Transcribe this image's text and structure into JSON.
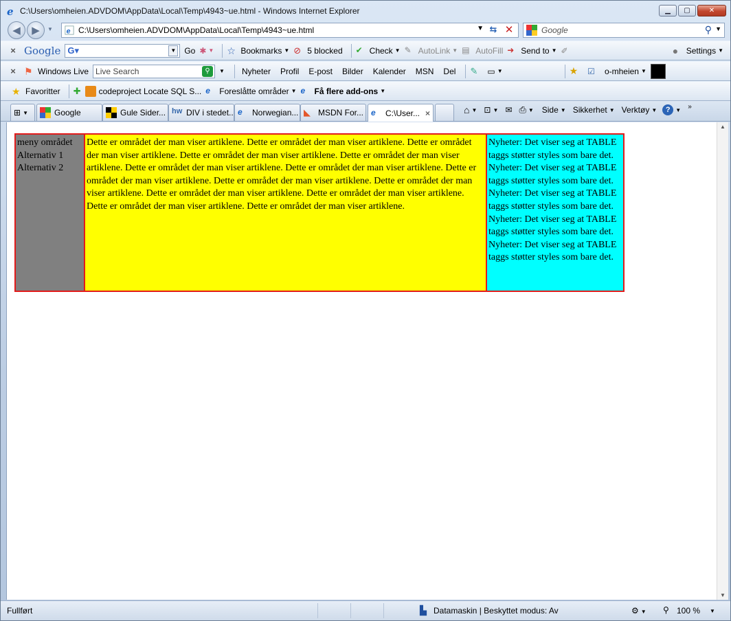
{
  "window": {
    "title": "C:\\Users\\omheien.ADVDOM\\AppData\\Local\\Temp\\4943~ue.html - Windows Internet Explorer"
  },
  "address": {
    "url": "C:\\Users\\omheien.ADVDOM\\AppData\\Local\\Temp\\4943~ue.html"
  },
  "search": {
    "placeholder": "Google"
  },
  "google_toolbar": {
    "logo": "Google",
    "go": "Go",
    "bookmarks": "Bookmarks",
    "blocked": "5 blocked",
    "check": "Check",
    "autolink": "AutoLink",
    "autofill": "AutoFill",
    "sendto": "Send to",
    "settings": "Settings"
  },
  "live_toolbar": {
    "brand": "Windows Live",
    "search_placeholder": "Live Search",
    "links": [
      "Nyheter",
      "Profil",
      "E-post",
      "Bilder",
      "Kalender",
      "MSN",
      "Del"
    ],
    "user": "o-mheien"
  },
  "favorites_bar": {
    "favorites": "Favoritter",
    "items": [
      "codeproject Locate SQL S...",
      "Foreslåtte områder",
      "Få flere add-ons"
    ]
  },
  "tabs": [
    {
      "label": "Google"
    },
    {
      "label": "Gule Sider..."
    },
    {
      "label": "DIV i stedet..."
    },
    {
      "label": "Norwegian..."
    },
    {
      "label": "MSDN For..."
    },
    {
      "label": "C:\\User..."
    }
  ],
  "commandbar": {
    "side": "Side",
    "sikkerhet": "Sikkerhet",
    "verktoy": "Verktøy"
  },
  "page": {
    "menu": [
      "meny området",
      "Alternativ 1",
      "Alternativ 2"
    ],
    "article": "Dette er området der man viser artiklene. Dette er området der man viser artiklene. Dette er området der man viser artiklene. Dette er området der man viser artiklene. Dette er området der man viser artiklene. Dette er området der man viser artiklene. Dette er området der man viser artiklene. Dette er området der man viser artiklene. Dette er området der man viser artiklene. Dette er området der man viser artiklene. Dette er området der man viser artiklene. Dette er området der man viser artiklene. Dette er området der man viser artiklene. Dette er området der man viser artiklene.",
    "news": "Nyheter: Det viser seg at TABLE taggs støtter styles som bare det. Nyheter: Det viser seg at TABLE taggs støtter styles som bare det. Nyheter: Det viser seg at TABLE taggs støtter styles som bare det. Nyheter: Det viser seg at TABLE taggs støtter styles som bare det. Nyheter: Det viser seg at TABLE taggs støtter styles som bare det."
  },
  "status": {
    "text": "Fullført",
    "zone": "Datamaskin | Beskyttet modus: Av",
    "zoom": "100 %"
  },
  "colors": {
    "menu_bg": "#808080",
    "article_bg": "#ffff00",
    "news_bg": "#00ffff",
    "border": "#e21a1a"
  }
}
